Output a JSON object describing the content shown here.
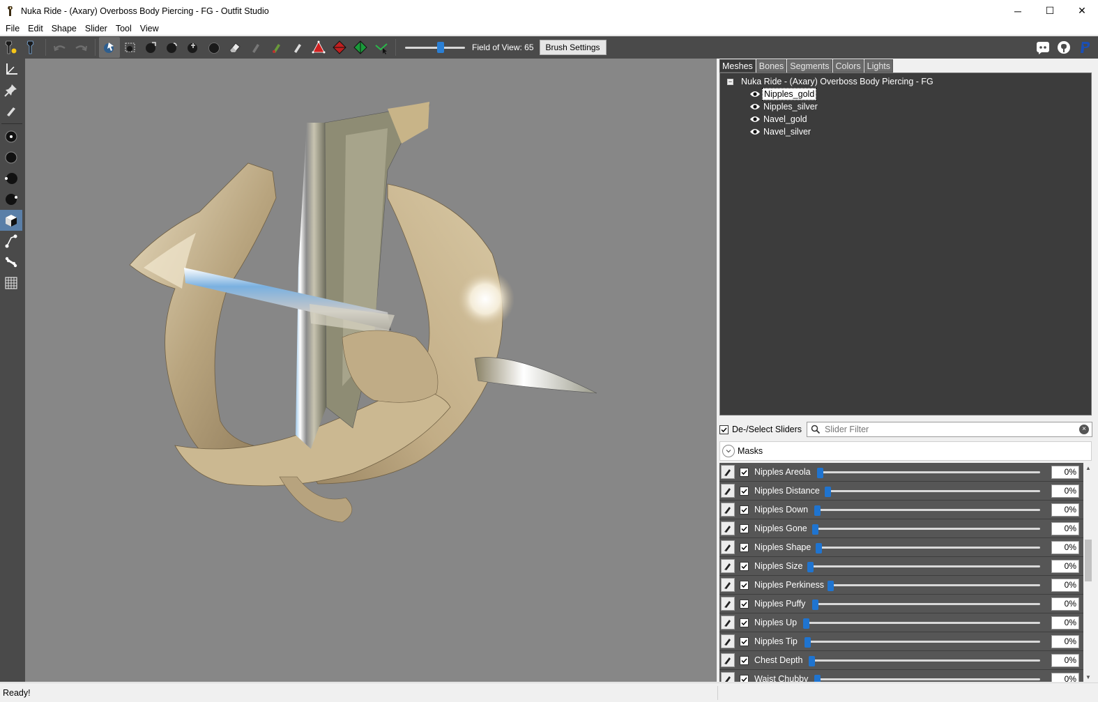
{
  "window": {
    "title": "Nuka Ride - (Axary) Overboss Body Piercing - FG - Outfit Studio",
    "minimize_glyph": "─",
    "maximize_glyph": "☐",
    "close_glyph": "✕"
  },
  "menu": [
    "File",
    "Edit",
    "Shape",
    "Slider",
    "Tool",
    "View"
  ],
  "toolbar": {
    "fov_label": "Field of View: 65",
    "fov_value": 65,
    "brush_settings_label": "Brush Settings"
  },
  "tabs": [
    "Meshes",
    "Bones",
    "Segments",
    "Colors",
    "Lights"
  ],
  "active_tab": "Meshes",
  "mesh_tree": {
    "root": "Nuka Ride - (Axary) Overboss Body Piercing - FG",
    "root_expander": "−",
    "items": [
      {
        "label": "Nipples_gold",
        "selected": true
      },
      {
        "label": "Nipples_silver",
        "selected": false
      },
      {
        "label": "Navel_gold",
        "selected": false
      },
      {
        "label": "Navel_silver",
        "selected": false
      }
    ]
  },
  "slider_panel": {
    "deselect_label": "De-/Select Sliders",
    "filter_placeholder": "Slider Filter",
    "group_label": "Masks",
    "clear_glyph": "×",
    "sliders": [
      {
        "name": "Nipples Areola",
        "value": "0%",
        "level": 0
      },
      {
        "name": "Nipples Distance",
        "value": "0%",
        "level": 0
      },
      {
        "name": "Nipples Down",
        "value": "0%",
        "level": 0
      },
      {
        "name": "Nipples Gone",
        "value": "0%",
        "level": 0
      },
      {
        "name": "Nipples Shape",
        "value": "0%",
        "level": 0
      },
      {
        "name": "Nipples Size",
        "value": "0%",
        "level": 0
      },
      {
        "name": "Nipples Perkiness",
        "value": "0%",
        "level": 0
      },
      {
        "name": "Nipples Puffy",
        "value": "0%",
        "level": 0
      },
      {
        "name": "Nipples Up",
        "value": "0%",
        "level": 0
      },
      {
        "name": "Nipples Tip",
        "value": "0%",
        "level": 0
      },
      {
        "name": "Chest Depth",
        "value": "0%",
        "level": 0
      },
      {
        "name": "Waist Chubby",
        "value": "0%",
        "level": 0
      }
    ]
  },
  "status": {
    "text": "Ready!"
  },
  "colors": {
    "toolbar_bg": "#4a4a4a",
    "viewport_bg": "#878787",
    "slider_thumb": "#1f74d0",
    "mesh_gold": "#c9b48e"
  }
}
